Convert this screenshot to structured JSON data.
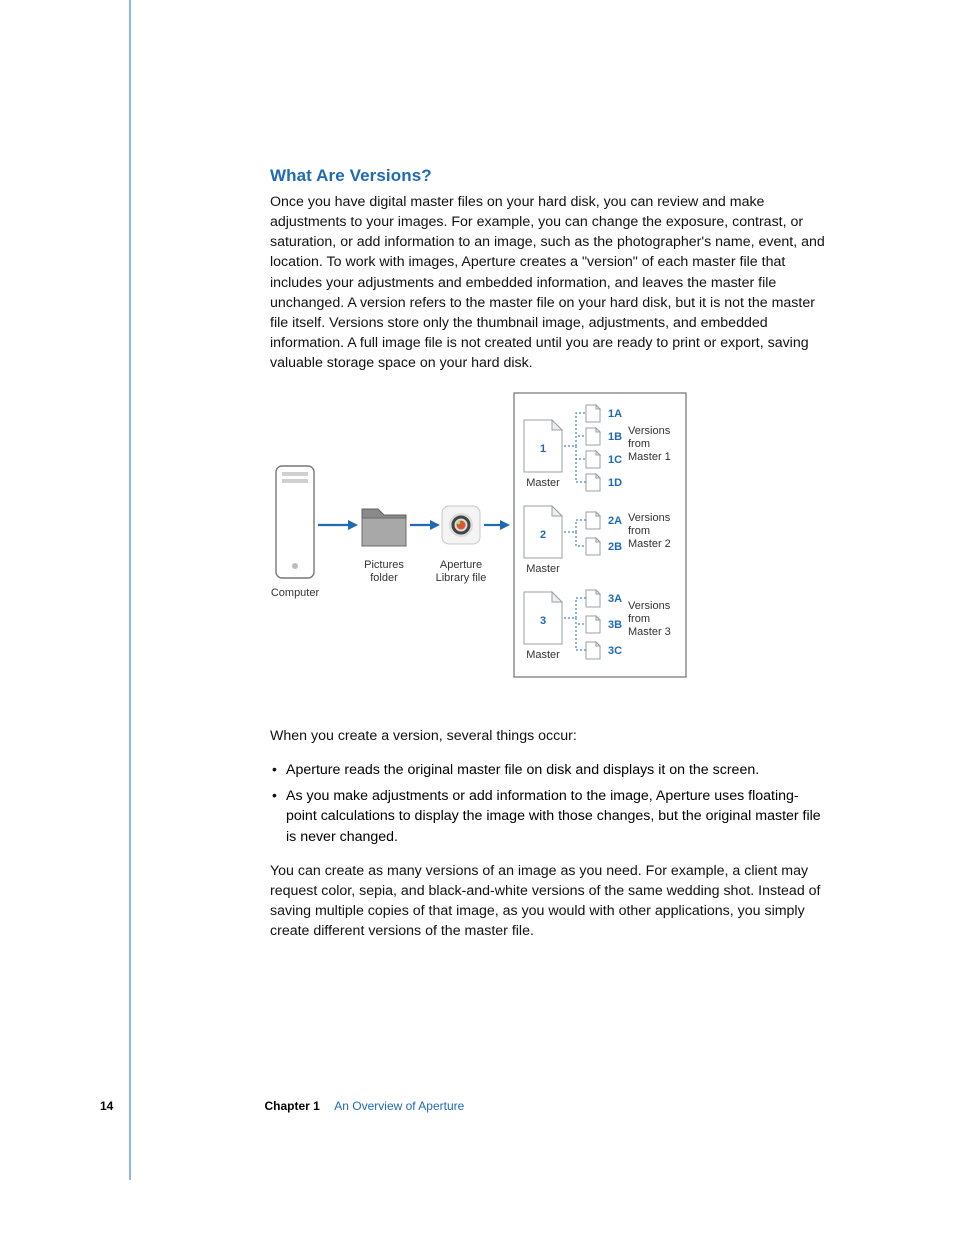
{
  "heading": "What Are Versions?",
  "para1": "Once you have digital master files on your hard disk, you can review and make adjustments to your images. For example, you can change the exposure, contrast, or saturation, or add information to an image, such as the photographer's name, event, and location. To work with images, Aperture creates a \"version\" of each master file that includes your adjustments and embedded information, and leaves the master file unchanged. A version refers to the master file on your hard disk, but it is not the master file itself. Versions store only the thumbnail image, adjustments, and embedded information. A full image file is not created until you are ready to print or export, saving valuable storage space on your hard disk.",
  "para_intro2": "When you create a version, several things occur:",
  "bullets": [
    "Aperture reads the original master file on disk and displays it on the screen.",
    "As you make adjustments or add information to the image, Aperture uses floating-point calculations to display the image with those changes, but the original master file is never changed."
  ],
  "para3": "You can create as many versions of an image as you need. For example, a client may request color, sepia, and black-and-white versions of the same wedding shot. Instead of saving multiple copies of that image, as you would with other applications, you simply create different versions of the master file.",
  "diagram": {
    "computer": "Computer",
    "pictures_folder_l1": "Pictures",
    "pictures_folder_l2": "folder",
    "aperture_lib_l1": "Aperture",
    "aperture_lib_l2": "Library file",
    "master_label": "Master",
    "m1": "1",
    "m2": "2",
    "m3": "3",
    "v1": [
      "1A",
      "1B",
      "1C",
      "1D"
    ],
    "v2": [
      "2A",
      "2B"
    ],
    "v3": [
      "3A",
      "3B",
      "3C"
    ],
    "vcap1_l1": "Versions",
    "vcap1_l2": "from",
    "vcap1_l3": "Master 1",
    "vcap2_l1": "Versions",
    "vcap2_l2": "from",
    "vcap2_l3": "Master 2",
    "vcap3_l1": "Versions",
    "vcap3_l2": "from",
    "vcap3_l3": "Master 3"
  },
  "footer": {
    "page": "14",
    "chapter": "Chapter 1",
    "chapter_title": "An Overview of Aperture"
  }
}
